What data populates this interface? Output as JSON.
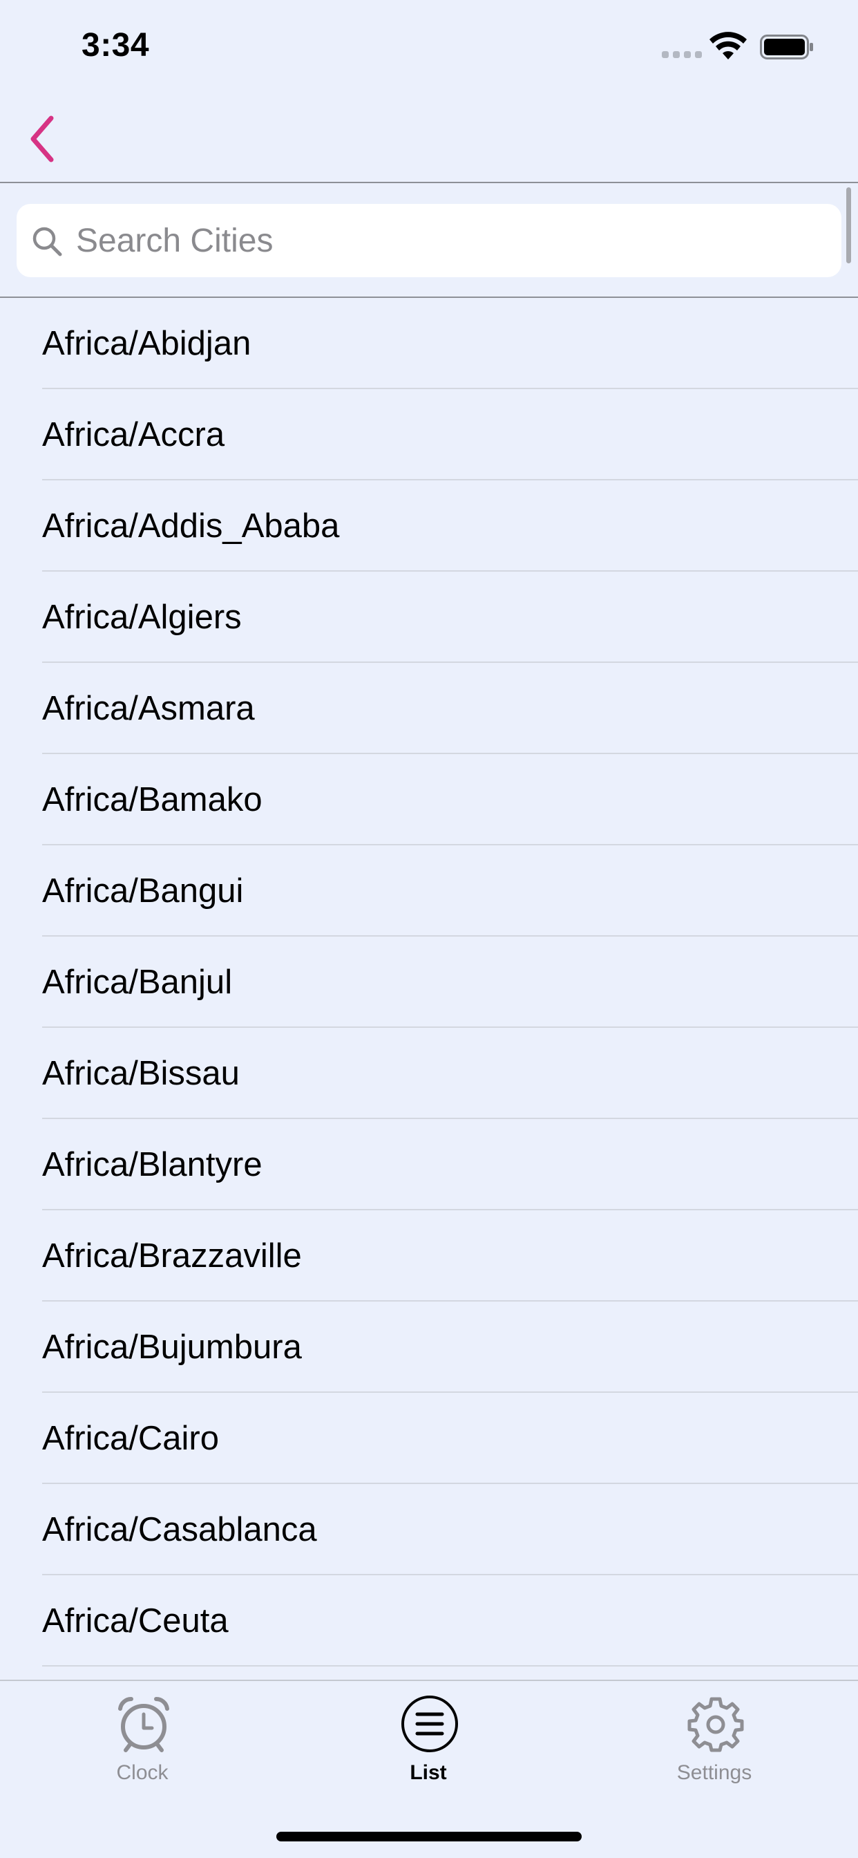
{
  "status_bar": {
    "time": "3:34",
    "icons": [
      "cellular-signal-icon",
      "wifi-icon",
      "battery-icon"
    ]
  },
  "nav": {
    "back_icon": "chevron-left-icon",
    "accent_color": "#d63384"
  },
  "search": {
    "placeholder": "Search Cities",
    "value": ""
  },
  "cities": [
    "Africa/Abidjan",
    "Africa/Accra",
    "Africa/Addis_Ababa",
    "Africa/Algiers",
    "Africa/Asmara",
    "Africa/Bamako",
    "Africa/Bangui",
    "Africa/Banjul",
    "Africa/Bissau",
    "Africa/Blantyre",
    "Africa/Brazzaville",
    "Africa/Bujumbura",
    "Africa/Cairo",
    "Africa/Casablanca",
    "Africa/Ceuta"
  ],
  "tabs": [
    {
      "label": "Clock",
      "icon": "alarm-clock-icon",
      "active": false
    },
    {
      "label": "List",
      "icon": "list-icon",
      "active": true
    },
    {
      "label": "Settings",
      "icon": "gear-icon",
      "active": false
    }
  ]
}
